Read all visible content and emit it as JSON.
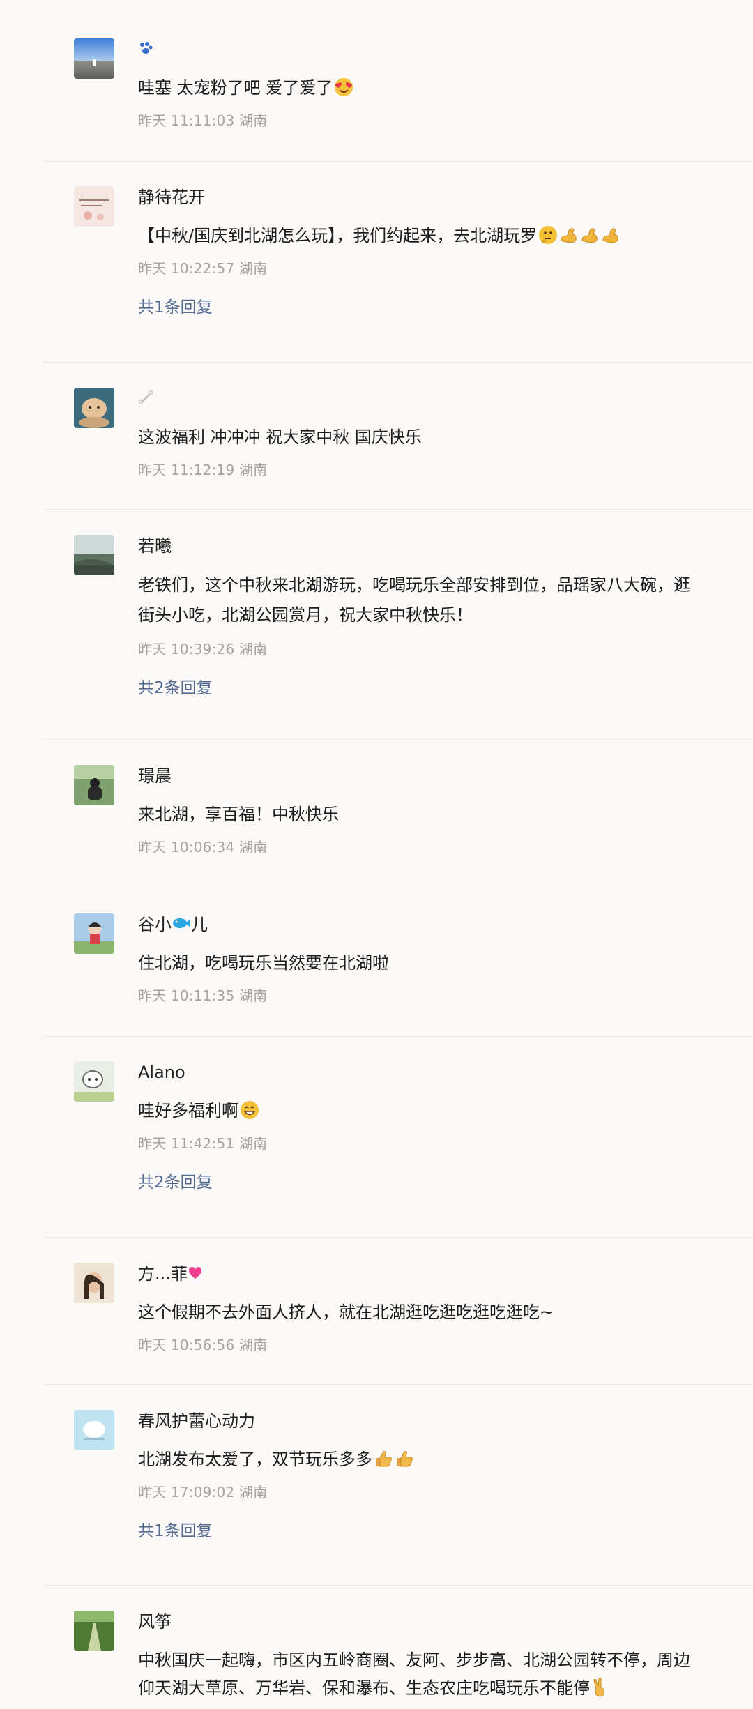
{
  "comments": [
    {
      "name": "",
      "name_icon": "paw-icon",
      "text": "哇塞 太宠粉了吧 爱了爱了",
      "emojis": [
        "heart-eyes-emoji"
      ],
      "time": "昨天 11:11:03 湖南",
      "replies": ""
    },
    {
      "name": "静待花开",
      "text": "【中秋/国庆到北湖怎么玩】，我们约起来，去北湖玩罗",
      "emojis": [
        "thinking-emoji",
        "flex-emoji",
        "flex-emoji",
        "flex-emoji"
      ],
      "time": "昨天 10:22:57 湖南",
      "replies": "共1条回复"
    },
    {
      "name": "",
      "name_icon": "bone-icon",
      "text": " 这波福利 冲冲冲 祝大家中秋 国庆快乐",
      "emojis": [],
      "time": "昨天 11:12:19 湖南",
      "replies": ""
    },
    {
      "name": "若曦",
      "text": "老铁们，这个中秋来北湖游玩，吃喝玩乐全部安排到位，品瑶家八大碗，逛街头小吃，北湖公园赏月，祝大家中秋快乐！",
      "emojis": [],
      "time": "昨天 10:39:26 湖南",
      "replies": "共2条回复"
    },
    {
      "name": "璟晨",
      "text": "来北湖，享百福！中秋快乐",
      "emojis": [],
      "time": "昨天 10:06:34 湖南",
      "replies": ""
    },
    {
      "name_prefix": "谷小",
      "name_icon": "fish-icon",
      "name_suffix": "儿",
      "text": "住北湖，吃喝玩乐当然要在北湖啦",
      "emojis": [],
      "time": "昨天 10:11:35 湖南",
      "replies": ""
    },
    {
      "name": "Alano",
      "text": "哇好多福利啊",
      "emojis": [
        "grin-emoji"
      ],
      "time": "昨天 11:42:51 湖南",
      "replies": "共2条回复"
    },
    {
      "name_prefix": "方...菲",
      "name_icon": "heart-icon",
      "name_suffix": "",
      "text": "这个假期不去外面人挤人，就在北湖逛吃逛吃逛吃逛吃~",
      "emojis": [],
      "time": "昨天 10:56:56 湖南",
      "replies": ""
    },
    {
      "name": "春风护蕾心动力",
      "text": "北湖发布太爱了，双节玩乐多多",
      "emojis": [
        "thumbs-up-emoji",
        "thumbs-up-emoji"
      ],
      "time": "昨天 17:09:02 湖南",
      "replies": "共1条回复"
    },
    {
      "name": "风筝",
      "text": "中秋国庆一起嗨，市区内五岭商圈、友阿、步步高、北湖公园转不停，周边仰天湖大草原、万华岩、保和瀑布、生态农庄吃喝玩乐不能停",
      "emojis": [
        "victory-emoji"
      ],
      "time": "",
      "replies": ""
    }
  ]
}
